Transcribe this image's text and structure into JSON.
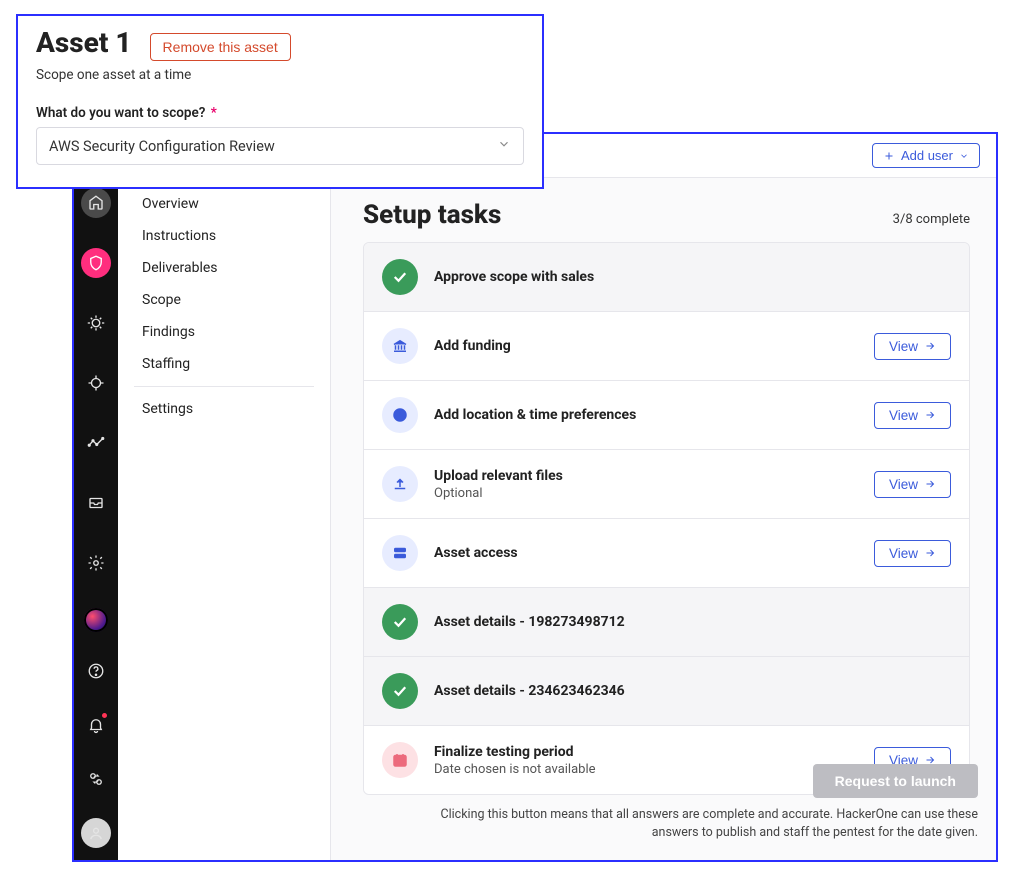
{
  "overlay": {
    "title": "Asset 1",
    "remove": "Remove this asset",
    "subtitle": "Scope one asset at a time",
    "question": "What do you want to scope?",
    "select_value": "AWS Security Configuration Review"
  },
  "topbar": {
    "add_user": "Add user"
  },
  "subnav": {
    "items": [
      "Overview",
      "Instructions",
      "Deliverables",
      "Scope",
      "Findings",
      "Staffing"
    ],
    "settings": "Settings"
  },
  "content": {
    "title": "Setup tasks",
    "complete": "3/8 complete"
  },
  "tasks": {
    "approve": {
      "title": "Approve scope with sales"
    },
    "funding": {
      "title": "Add funding"
    },
    "location": {
      "title": "Add location & time preferences"
    },
    "upload": {
      "title": "Upload relevant files",
      "sub": "Optional"
    },
    "access": {
      "title": "Asset access"
    },
    "asset1": {
      "title": "Asset details - 198273498712"
    },
    "asset2": {
      "title": "Asset details - 234623462346"
    },
    "finalize": {
      "title": "Finalize testing period",
      "sub": "Date chosen is not available"
    },
    "view": "View"
  },
  "footer": {
    "launch": "Request to launch",
    "disclaimer": "Clicking this button means that all answers are complete and accurate. HackerOne can use these answers to publish and staff the pentest for the date given."
  }
}
